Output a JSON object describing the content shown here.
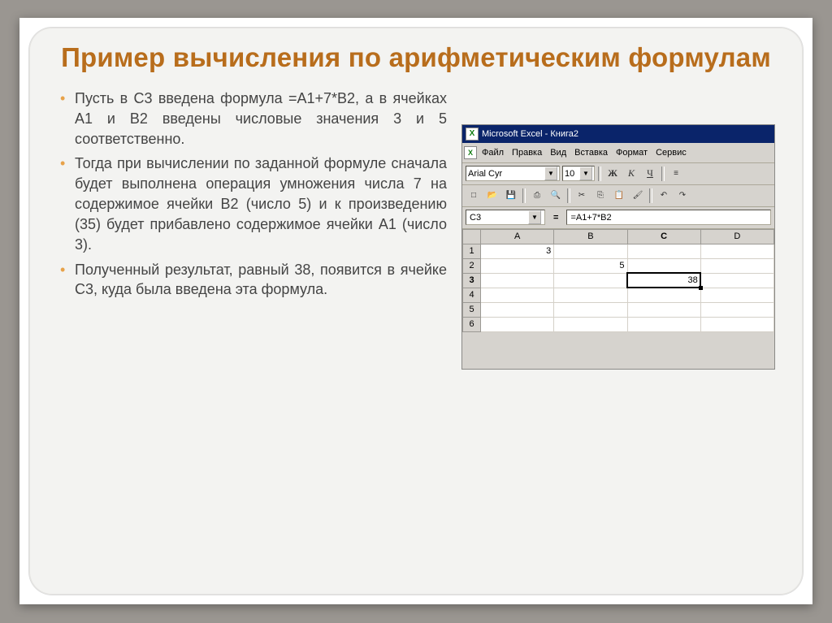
{
  "title": "Пример вычисления по арифметическим формулам",
  "bullets": [
    "Пусть в С3 введена формула =А1+7*В2, а в ячейках А1 и В2 введены числовые значения 3 и 5 соответственно.",
    "Тогда при вычислении по заданной формуле сначала будет выполнена операция умножения числа 7 на содержимое ячейки В2 (число 5) и к произведению (35) будет прибавлено содержимое ячейки А1 (число 3).",
    "Полученный результат, равный 38, появится в ячейке С3, куда была введена эта формула."
  ],
  "excel": {
    "app_title": "Microsoft Excel - Книга2",
    "menu": [
      "Файл",
      "Правка",
      "Вид",
      "Вставка",
      "Формат",
      "Сервис"
    ],
    "font_name": "Arial Cyr",
    "font_size": "10",
    "format_buttons": {
      "bold": "Ж",
      "italic": "К",
      "underline": "Ч"
    },
    "name_box": "C3",
    "formula": "=A1+7*B2",
    "columns": [
      "A",
      "B",
      "C",
      "D"
    ],
    "rows": [
      "1",
      "2",
      "3",
      "4",
      "5",
      "6"
    ],
    "cells": {
      "A1": "3",
      "B2": "5",
      "C3": "38"
    },
    "selected_cell": "C3"
  }
}
